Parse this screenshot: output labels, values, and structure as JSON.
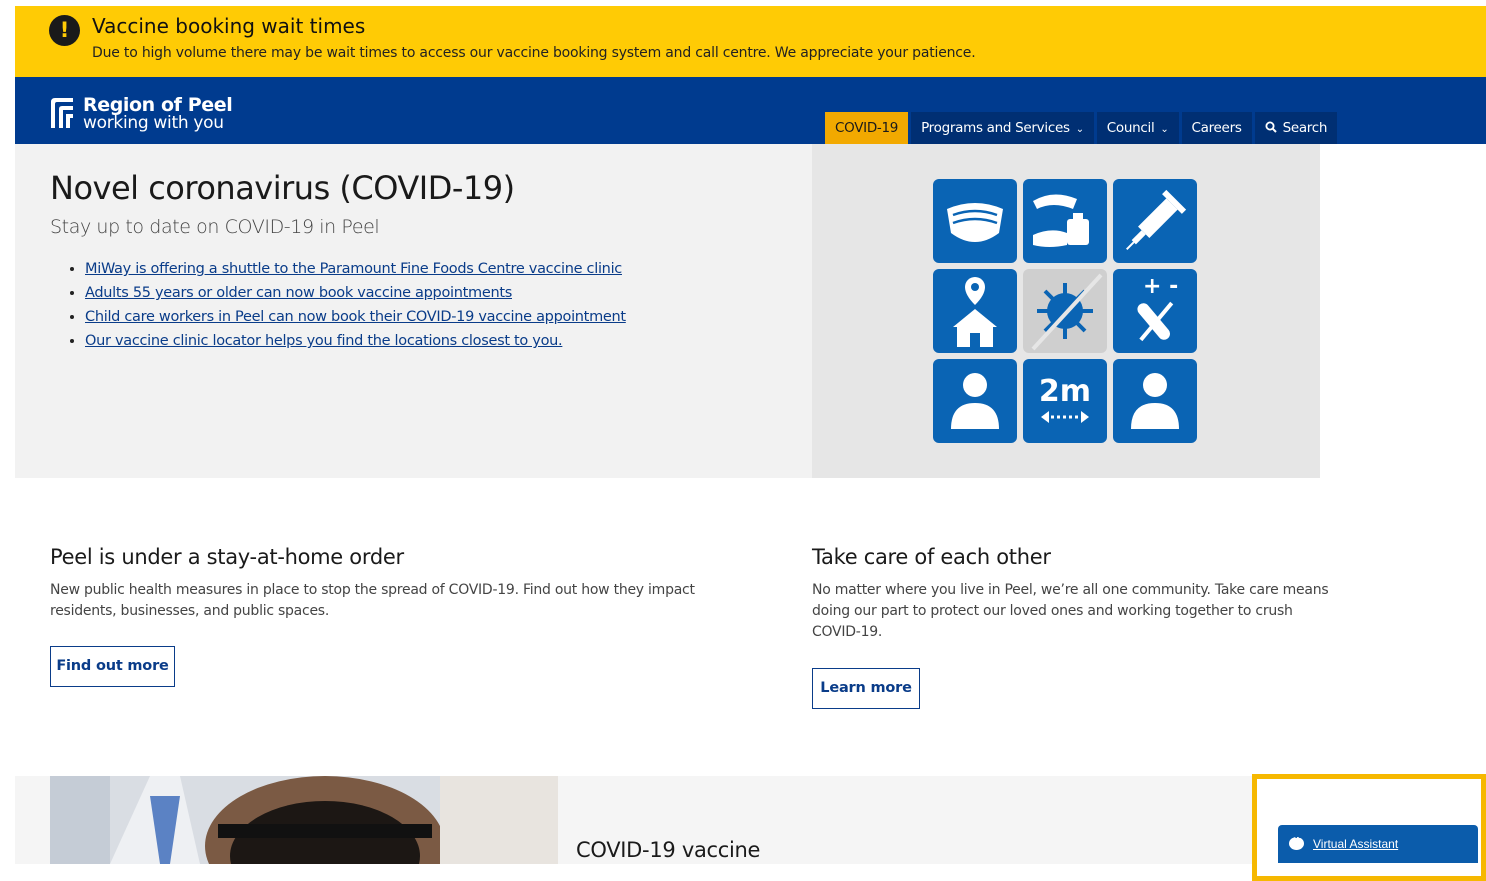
{
  "alert": {
    "title": "Vaccine booking wait times",
    "text": "Due to high volume there may be wait times to access our vaccine booking system and call centre. We appreciate your patience."
  },
  "header": {
    "logo_name": "Region of Peel",
    "logo_tagline": "working with you",
    "nav": [
      {
        "label": "COVID-19",
        "active": true
      },
      {
        "label": "Programs and Services",
        "dropdown": true
      },
      {
        "label": "Council",
        "dropdown": true
      },
      {
        "label": "Careers"
      },
      {
        "label": "Search",
        "icon": "search-icon"
      }
    ]
  },
  "hero": {
    "title": "Novel coronavirus (COVID-19)",
    "subtitle": "Stay up to date on COVID-19 in Peel",
    "links": [
      "MiWay is offering a shuttle to the Paramount Fine Foods Centre vaccine clinic",
      "Adults 55 years or older can now book vaccine appointments",
      "Child care workers in Peel can now book their COVID-19 vaccine appointment",
      "Our vaccine clinic locator helps you find the locations closest to you."
    ],
    "tiles": [
      "mask-icon",
      "hand-sanitizer-icon",
      "syringe-icon",
      "home-location-icon",
      "virus-icon",
      "test-kit-icon",
      "person-icon",
      "distance-2m-icon",
      "person-icon"
    ],
    "distance_label": "2m",
    "tile_color": "#0a64b4"
  },
  "cards": [
    {
      "title": "Peel is under a stay-at-home order",
      "text": "New public health measures in place to stop the spread of COVID-19. Find out how they impact residents, businesses, and public spaces.",
      "button": "Find out more"
    },
    {
      "title": "Take care of each other",
      "text": "No matter where you live in Peel, we’re all one community. Take care means doing our part to protect our loved ones and working together to crush COVID-19.",
      "button": "Learn more"
    }
  ],
  "vaccine_section": {
    "heading": "COVID-19 vaccine"
  },
  "virtual_assistant": {
    "label": "Virtual Assistant"
  },
  "colors": {
    "alert": "#ffcb05",
    "nav": "#003b8f",
    "active_tab": "#f2a900",
    "link": "#0a3c89"
  }
}
